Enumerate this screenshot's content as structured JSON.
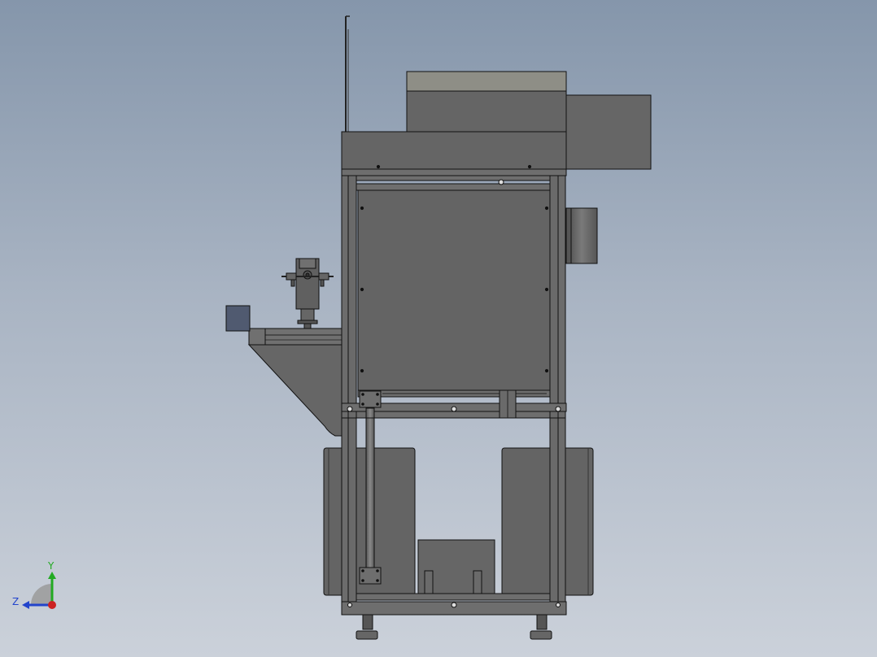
{
  "view": {
    "type": "cad-side-view",
    "background_top": "#8596ab",
    "background_bottom": "#cbd1da",
    "part_fill": "#666666",
    "frame_fill": "#6b6b6b",
    "top_plate_fill": "#8d8d84",
    "edge_color": "#111111"
  },
  "triad": {
    "y_label": "Y",
    "z_label": "Z",
    "y_color": "#22aa22",
    "z_color": "#2244cc",
    "origin_color": "#cc2222"
  }
}
